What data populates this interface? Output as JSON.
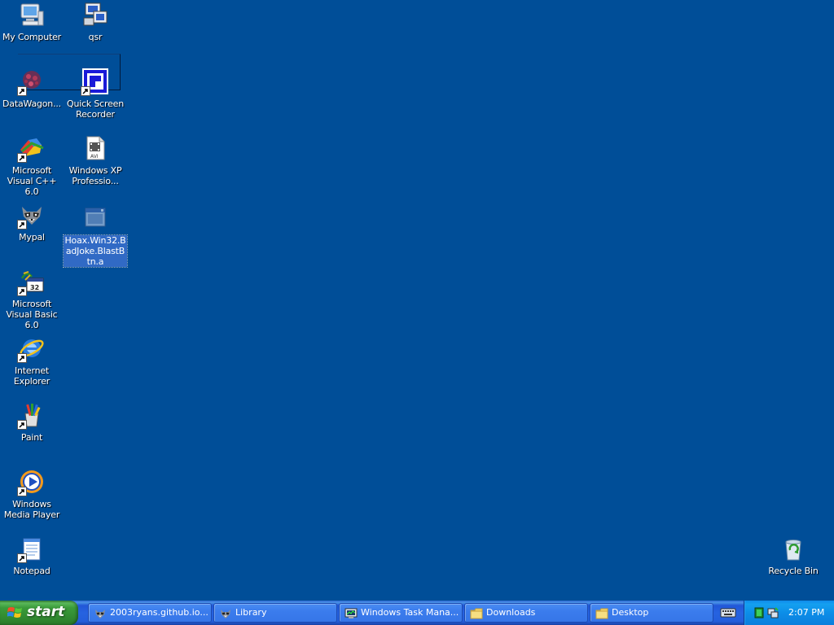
{
  "desktop": {
    "background_color": "#004e98",
    "icons": [
      {
        "label": "My Computer",
        "icon": "my-computer-icon"
      },
      {
        "label": "qsr",
        "icon": "qsr-icon"
      },
      {
        "label": "DataWagon...",
        "icon": "datawagon-icon"
      },
      {
        "label": "Quick Screen Recorder",
        "icon": "quick-screen-recorder-icon"
      },
      {
        "label": "Microsoft Visual C++ 6.0",
        "icon": "visual-cpp-icon"
      },
      {
        "label": "Windows XP Professio...",
        "icon": "avi-file-icon"
      },
      {
        "label": "Mypal",
        "icon": "mypal-raccoon-icon"
      },
      {
        "label": "Hoax.Win32.BadJoke.BlastBtn.a",
        "icon": "executable-window-icon",
        "selected": true
      },
      {
        "label": "Microsoft Visual Basic 6.0",
        "icon": "visual-basic-icon"
      },
      {
        "label": "Internet Explorer",
        "icon": "internet-explorer-icon"
      },
      {
        "label": "Paint",
        "icon": "paint-icon"
      },
      {
        "label": "Windows Media Player",
        "icon": "windows-media-player-icon"
      },
      {
        "label": "Notepad",
        "icon": "notepad-icon"
      },
      {
        "label": "Recycle Bin",
        "icon": "recycle-bin-icon"
      }
    ]
  },
  "taskbar": {
    "start_label": "start",
    "tasks": [
      {
        "label": "2003ryans.github.io...",
        "icon": "mypal-raccoon-icon"
      },
      {
        "label": "Library",
        "icon": "mypal-raccoon-icon"
      },
      {
        "label": "Windows Task Mana...",
        "icon": "task-manager-icon"
      },
      {
        "label": "Downloads",
        "icon": "folder-icon"
      },
      {
        "label": "Desktop",
        "icon": "folder-icon"
      }
    ],
    "tray": {
      "clock": "2:07 PM",
      "icons": [
        "keyboard-icon",
        "green-square-icon",
        "network-icon"
      ]
    }
  }
}
